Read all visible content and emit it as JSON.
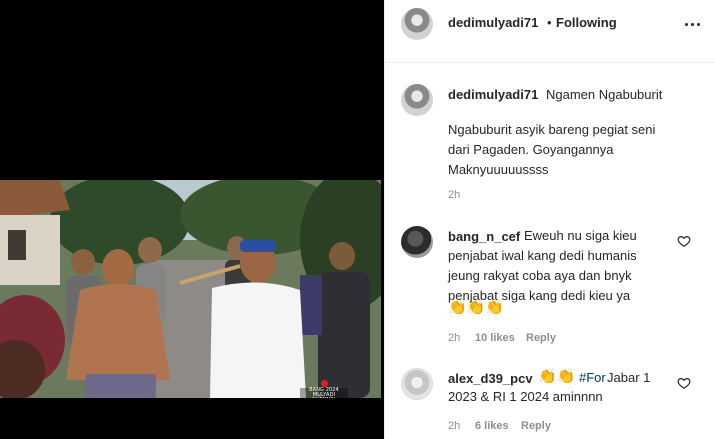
{
  "video": {
    "channel_logo_text": "BANG 2024 MULYADI CHANNEL"
  },
  "header": {
    "username": "dedimulyadi71",
    "separator": "•",
    "follow_status": "Following",
    "more_icon": "more-horizontal-icon"
  },
  "caption": {
    "username": "dedimulyadi71",
    "title": "Ngamen Ngabuburit",
    "body": "Ngabuburit asyik bareng pegiat seni\ndari Pagaden. Goyangannya\nMaknyuuuuussss",
    "time": "2h"
  },
  "comments": [
    {
      "username": "bang_n_cef",
      "line1": "Eweuh nu siga kieu",
      "line2": "penjabat iwal kang dedi humanis",
      "line3": "jeung rakyat coba aya dan bnyk",
      "line4": "penjabat siga kang dedi kieu ya",
      "emoji": "👏👏👏",
      "time": "2h",
      "likes": "10 likes",
      "reply": "Reply"
    },
    {
      "username": "alex_d39_pcv",
      "emoji": "👏👏",
      "hashtag": "#For",
      "line1_rest": "Jabar 1",
      "line2": "2023 & RI 1 2024 aminnnn",
      "time": "2h",
      "likes": "6 likes",
      "reply": "Reply"
    }
  ],
  "colors": {
    "text": "#262626",
    "muted": "#8e8e8e",
    "hashtag": "#00376b",
    "divider": "#efefef"
  }
}
